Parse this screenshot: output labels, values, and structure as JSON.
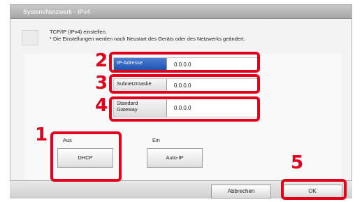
{
  "window": {
    "title": "System/Netzwerk - IPv4"
  },
  "info": {
    "line1": "TCP/IP (IPv4) einstellen.",
    "line2": "* Die Einstellungen werden nach Neustart des Geräts oder des Netzwerks geändert."
  },
  "fields": [
    {
      "label": "IP-Adresse",
      "value": "0.0.0.0",
      "callout": "2"
    },
    {
      "label": "Subnetzmaske",
      "value": "0.0.0.0",
      "callout": "3"
    },
    {
      "label_line1": "Standard",
      "label_line2": "Gateway",
      "value": "0.0.0.0",
      "callout": "4"
    }
  ],
  "dhcp": {
    "group_label": "Aus",
    "button_label": "DHCP",
    "callout": "1"
  },
  "autoip": {
    "group_label": "Ein",
    "button_label": "Auto-IP"
  },
  "footer": {
    "cancel_label": "Abbrechen",
    "ok_label": "OK",
    "ok_callout": "5"
  },
  "colors": {
    "callout": "#e2001a",
    "active_field": "#1e4fae",
    "title_bar": "#a6a6a6"
  }
}
